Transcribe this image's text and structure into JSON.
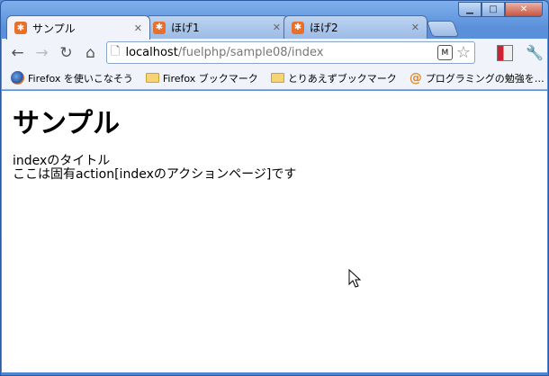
{
  "window": {
    "min_glyph": "▁",
    "max_glyph": "□",
    "close_glyph": "✕"
  },
  "tabs": [
    {
      "title": "サンプル",
      "favicon": "fuel-icon",
      "active": true
    },
    {
      "title": "ほげ1",
      "favicon": "fuel-icon",
      "active": false
    },
    {
      "title": "ほげ2",
      "favicon": "fuel-icon",
      "active": false
    }
  ],
  "toolbar": {
    "url_host": "localhost",
    "url_path": "/fuelphp/sample08/index"
  },
  "bookmarks": [
    {
      "label": "Firefox を使いこなそう",
      "icon": "firefox-icon"
    },
    {
      "label": "Firefox ブックマーク",
      "icon": "folder-icon"
    },
    {
      "label": "とりあえずブックマーク",
      "icon": "folder-icon"
    },
    {
      "label": "プログラミングの勉強を…",
      "icon": "at-icon"
    }
  ],
  "content": {
    "heading": "サンプル",
    "line1": "indexのタイトル",
    "line2": "ここは固有action[indexのアクションページ]です"
  }
}
